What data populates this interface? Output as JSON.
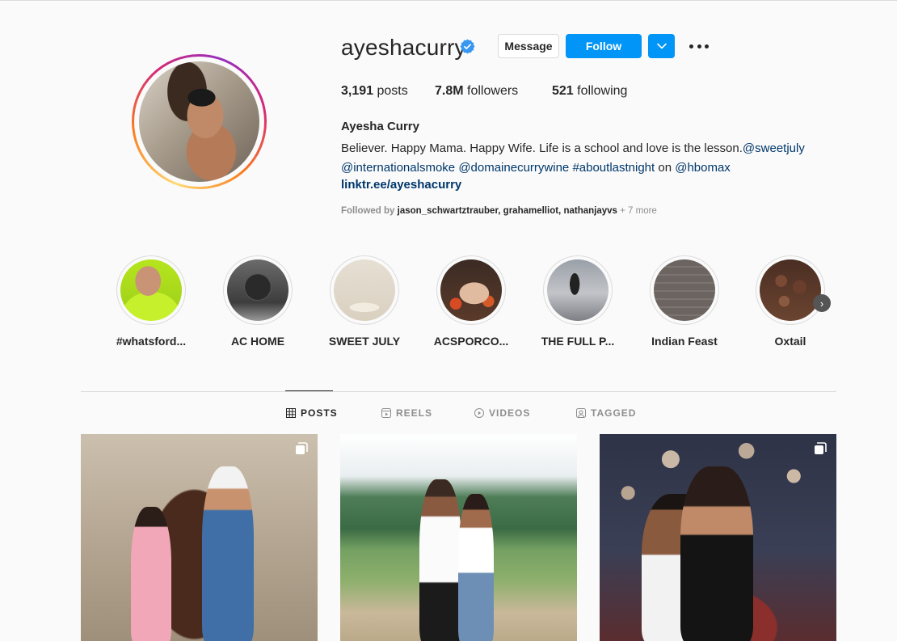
{
  "profile": {
    "username": "ayeshacurry",
    "verified": true,
    "buttons": {
      "message": "Message",
      "follow": "Follow"
    },
    "stats": {
      "posts_count": "3,191",
      "posts_label": "posts",
      "followers_count": "7.8M",
      "followers_label": "followers",
      "following_count": "521",
      "following_label": "following"
    },
    "full_name": "Ayesha Curry",
    "bio": {
      "text": "Believer. Happy Mama. Happy Wife. Life is a school and love is the lesson.",
      "tag1": "@sweetjuly",
      "tag2": "@internationalsmoke",
      "tag3": "@domainecurrywine",
      "tag4": "#aboutlastnight",
      "on_text": "on",
      "tag5": "@hbomax"
    },
    "link": "linktr.ee/ayeshacurry",
    "followed_by": {
      "prefix": "Followed by",
      "names": "jason_schwartztrauber, grahamelliot, nathanjayvs",
      "more": "+ 7 more"
    }
  },
  "highlights": [
    {
      "label": "#whatsford..."
    },
    {
      "label": "AC HOME"
    },
    {
      "label": "SWEET JULY"
    },
    {
      "label": "ACSPORCO..."
    },
    {
      "label": "THE FULL P..."
    },
    {
      "label": "Indian Feast"
    },
    {
      "label": "Oxtail"
    }
  ],
  "tabs": {
    "posts": "POSTS",
    "reels": "REELS",
    "videos": "VIDEOS",
    "tagged": "TAGGED"
  },
  "icons": {
    "verified": "verified-badge-icon",
    "dropdown": "chevron-down-icon",
    "more": "more-options-icon",
    "grid": "grid-icon",
    "reels": "reels-icon",
    "videos": "play-icon",
    "tagged": "tagged-icon",
    "multi": "carousel-icon",
    "next": "chevron-right-icon"
  },
  "colors": {
    "accent": "#0095f6",
    "link": "#00376b",
    "text": "#262626",
    "muted": "#8e8e8e"
  }
}
